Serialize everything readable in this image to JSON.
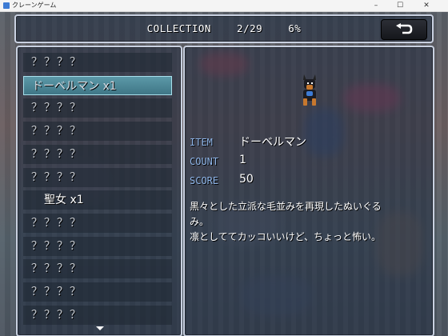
{
  "window": {
    "title": "クレーンゲーム",
    "minimize": "–",
    "maximize": "☐",
    "close": "✕"
  },
  "header": {
    "label": "COLLECTION",
    "progress": "2/29",
    "percent": "6%",
    "back_icon": "return-arrow-icon"
  },
  "list": {
    "items": [
      {
        "label": "？？？？",
        "state": "unknown"
      },
      {
        "label": "ドーベルマン x1",
        "state": "selected"
      },
      {
        "label": "？？？？",
        "state": "unknown"
      },
      {
        "label": "？？？？",
        "state": "unknown"
      },
      {
        "label": "？？？？",
        "state": "unknown"
      },
      {
        "label": "？？？？",
        "state": "unknown"
      },
      {
        "label": "聖女 x1",
        "state": "known"
      },
      {
        "label": "？？？？",
        "state": "unknown"
      },
      {
        "label": "？？？？",
        "state": "unknown"
      },
      {
        "label": "？？？？",
        "state": "unknown"
      },
      {
        "label": "？？？？",
        "state": "unknown"
      },
      {
        "label": "？？？？",
        "state": "unknown"
      }
    ]
  },
  "detail": {
    "item_label": "ITEM",
    "item_value": "ドーベルマン",
    "count_label": "COUNT",
    "count_value": "1",
    "score_label": "SCORE",
    "score_value": "50",
    "desc_line1": "黒々とした立派な毛並みを再現したぬいぐる",
    "desc_line2": "み。",
    "desc_line3": "凛としててカッコいいけど、ちょっと怖い。"
  }
}
